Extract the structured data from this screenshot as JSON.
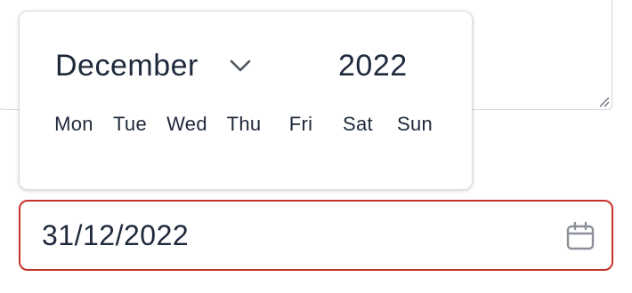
{
  "date_picker": {
    "month": "December",
    "year": "2022",
    "weekdays": [
      "Mon",
      "Tue",
      "Wed",
      "Thu",
      "Fri",
      "Sat",
      "Sun"
    ]
  },
  "date_input": {
    "value": "31/12/2022",
    "state": "error",
    "border_color": "#c5322a",
    "icon": "calendar-icon"
  },
  "month_dropdown_icon": "chevron-down-icon",
  "textarea_icon": "resize-handle-icon"
}
